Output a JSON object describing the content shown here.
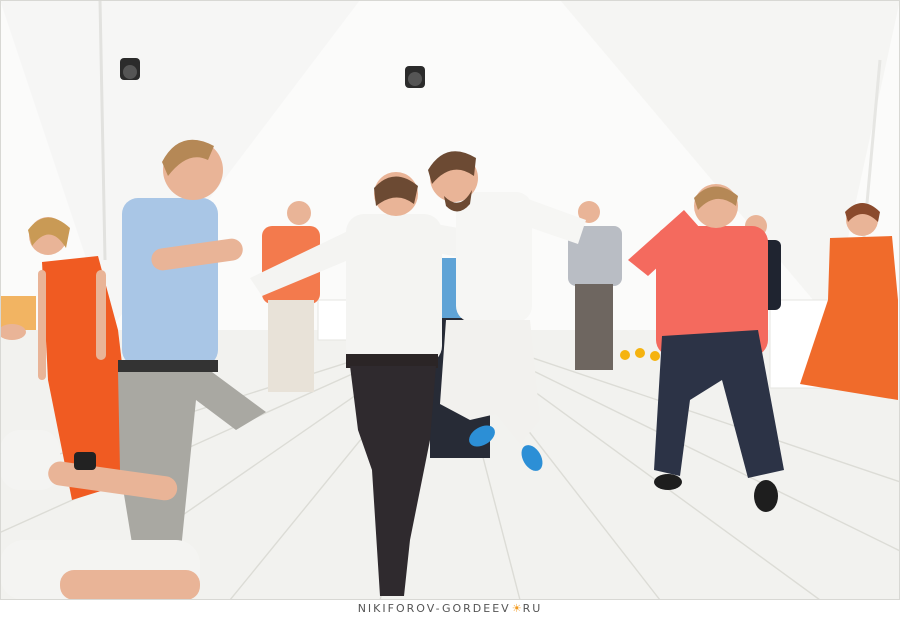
{
  "photo": {
    "subject": "wedding-party-dance",
    "colors": {
      "tent": "#fbfbfa",
      "floor": "#f2f2ef",
      "floor_line": "#dcdcd6",
      "coral_shirt": "#f46a5e",
      "orange_dress": "#f05b22",
      "blue_shirt": "#a9c6e6",
      "white_shirt": "#f4f4f2",
      "grey_pants": "#a9a8a2",
      "dark_pants": "#2f2a2e",
      "navy_pants": "#2c3346",
      "blue_shoes": "#2c8fd6",
      "skin": "#e9b497",
      "hair_blond": "#b58856",
      "hair_brown": "#6c4a33"
    }
  },
  "watermark": {
    "before_sun": "NIKIFOROV-GORDEEV",
    "sun_icon": "sun-icon",
    "after_sun": "RU"
  }
}
